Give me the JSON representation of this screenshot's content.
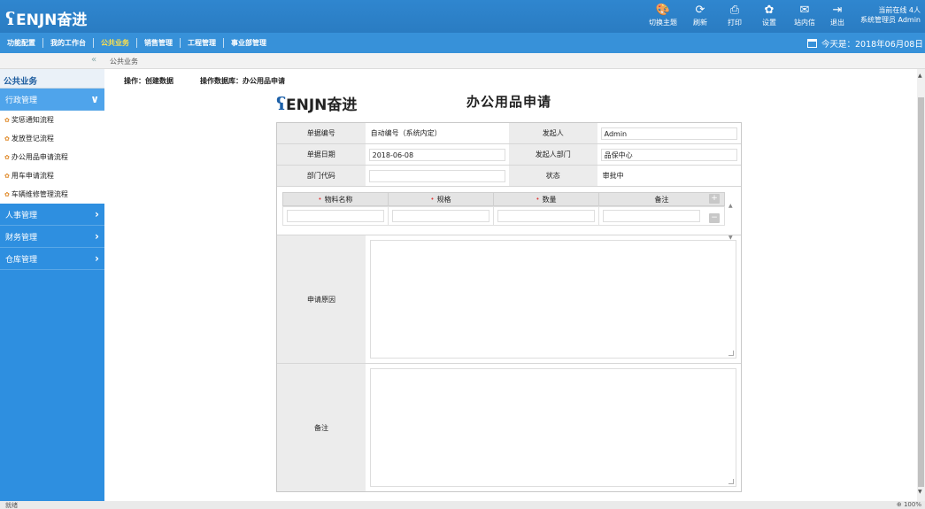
{
  "app": {
    "logo_symbol": "ʕ",
    "logo_text": "ENJN奋进"
  },
  "toolbar": [
    {
      "icon": "palette-icon",
      "glyph": "🎨",
      "label": "切换主题"
    },
    {
      "icon": "refresh-icon",
      "glyph": "⟳",
      "label": "刷新"
    },
    {
      "icon": "print-icon",
      "glyph": "⎙",
      "label": "打印"
    },
    {
      "icon": "gear-icon",
      "glyph": "✿",
      "label": "设置"
    },
    {
      "icon": "mail-icon",
      "glyph": "✉",
      "label": "站内信"
    },
    {
      "icon": "logout-icon",
      "glyph": "⇥",
      "label": "退出"
    }
  ],
  "online": {
    "line1": "当前在线 4人",
    "line2": "系统管理员 Admin"
  },
  "nav": {
    "items": [
      "功能配置",
      "我的工作台",
      "公共业务",
      "销售管理",
      "工程管理",
      "事业部管理"
    ],
    "active_index": 2
  },
  "date": {
    "text": "今天是：2018年06月08日"
  },
  "breadcrumb": {
    "collapse": "«",
    "text": "公共业务"
  },
  "sidebar": {
    "title": "公共业务",
    "groups": [
      {
        "label": "行政管理",
        "chevron": "∨"
      },
      {
        "label": "人事管理",
        "chevron": "›"
      },
      {
        "label": "财务管理",
        "chevron": "›"
      },
      {
        "label": "仓库管理",
        "chevron": "›"
      }
    ],
    "sub_items": [
      "奖惩通知流程",
      "发放登记流程",
      "办公用品申请流程",
      "用车申请流程",
      "车辆维修管理流程"
    ]
  },
  "operation": {
    "op": "操作：创建数据",
    "db": "操作数据库：办公用品申请"
  },
  "form": {
    "logo_symbol": "ʕ",
    "logo_text": "ENJN奋进",
    "title": "办公用品申请",
    "fields": {
      "doc_no_label": "单据编号",
      "doc_no_value": "自动编号（系统内定）",
      "initiator_label": "发起人",
      "initiator_value": "Admin",
      "doc_date_label": "单据日期",
      "doc_date_value": "2018-06-08",
      "dept_label": "发起人部门",
      "dept_value": "品保中心",
      "dept_code_label": "部门代码",
      "dept_code_value": "",
      "status_label": "状态",
      "status_value": "审批中"
    },
    "subtable": {
      "required_mark": "•",
      "headers": [
        "物料名称",
        "规格",
        "数量",
        "备注"
      ],
      "add": "+",
      "remove": "−"
    },
    "reason_label": "申请原因",
    "remark_label": "备注"
  },
  "status": {
    "left": "就绪",
    "right": "⊕ 100%"
  }
}
